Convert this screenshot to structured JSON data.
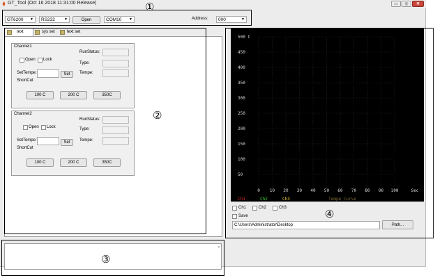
{
  "window": {
    "title": "GT_Tool (Oct 16 2018  11:31:00 Release)",
    "controls": {
      "minimize": "▭",
      "maximize": "◎",
      "close": "✕"
    }
  },
  "toolbar": {
    "model": "GT6200",
    "interface": "RS232",
    "open_label": "Open",
    "port": "COM10",
    "address_label": "Address:",
    "address_value": "000"
  },
  "tabs": [
    {
      "label": "text"
    },
    {
      "label": "sys set"
    },
    {
      "label": "text set"
    }
  ],
  "channels": [
    {
      "title": "Channel1",
      "open_label": "Open",
      "lock_label": "Lock",
      "runstatus_label": "RunStatus:",
      "type_label": "Type:",
      "tempe_label": "Tempe:",
      "settempe_label": "SetTempe:",
      "set_label": "Set",
      "shortcut_label": "ShortCut",
      "shortcuts": [
        "100 C",
        "200 C",
        "350C"
      ]
    },
    {
      "title": "Channel2",
      "open_label": "Open",
      "lock_label": "Lock",
      "runstatus_label": "RunStatus:",
      "type_label": "Type:",
      "tempe_label": "Tempe:",
      "settempe_label": "SetTempe:",
      "set_label": "Set",
      "shortcut_label": "ShortCut",
      "shortcuts": [
        "100 C",
        "200 C",
        "350C"
      ]
    }
  ],
  "chart_data": {
    "type": "line",
    "y_ticks": [
      "500 C",
      "450",
      "400",
      "350",
      "300",
      "250",
      "200",
      "150",
      "100",
      "50"
    ],
    "x_ticks": [
      "0",
      "10",
      "20",
      "30",
      "40",
      "50",
      "60",
      "70",
      "80",
      "90",
      "100",
      "Sec"
    ],
    "ylim": [
      0,
      500
    ],
    "xlim": [
      0,
      100
    ],
    "grid": true,
    "series": [
      {
        "name": "Ch1",
        "values": [],
        "color": "#e03030"
      },
      {
        "name": "Ch2",
        "values": [],
        "color": "#38d038"
      },
      {
        "name": "Ch3",
        "values": [],
        "color": "#e8d040"
      }
    ],
    "title": "Tempe curve",
    "title_color": "#7a6a30",
    "background": "#000000"
  },
  "chart_controls": {
    "ch1_label": "Ch1",
    "ch2_label": "Ch2",
    "ch3_label": "Ch3",
    "save_label": "Save",
    "path_value": "C:\\Users\\Administrator\\Desktop",
    "path_button": "Path..."
  },
  "annotations": [
    "①",
    "②",
    "③",
    "④"
  ]
}
